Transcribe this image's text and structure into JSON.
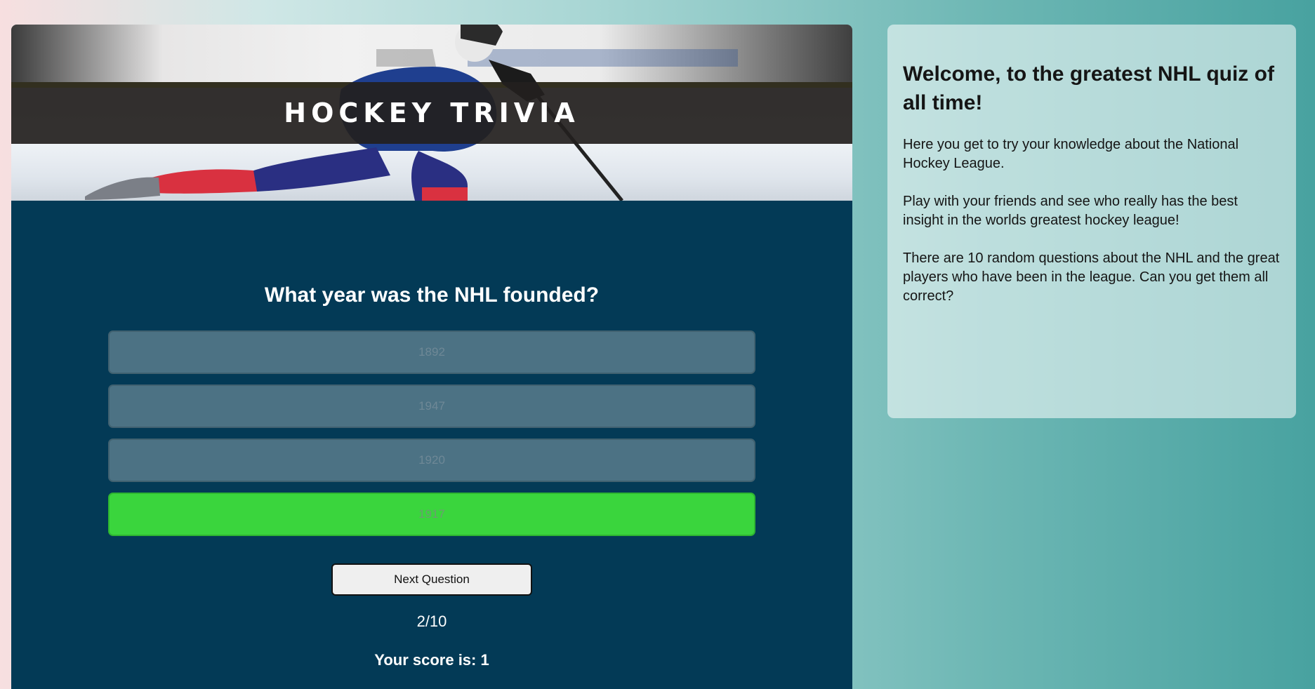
{
  "hero": {
    "title": "HOCKEY TRIVIA"
  },
  "quiz": {
    "question": "What year was the NHL founded?",
    "answers": [
      {
        "label": "1892",
        "state": "incorrect"
      },
      {
        "label": "1947",
        "state": "incorrect"
      },
      {
        "label": "1920",
        "state": "incorrect"
      },
      {
        "label": "1917",
        "state": "correct"
      }
    ],
    "next_button": "Next Question",
    "progress": "2/10",
    "score": "Your score is: 1"
  },
  "info": {
    "heading": "Welcome, to the greatest NHL quiz of all time!",
    "paragraphs": [
      "Here you get to try your knowledge about the National Hockey League.",
      "Play with your friends and see who really has the best insight in the worlds greatest hockey league!",
      "There are 10 random questions about the NHL and the great players who have been in the league. Can you get them all correct?"
    ]
  },
  "colors": {
    "quiz_bg": "#033a56",
    "answer_bg": "#4c7284",
    "correct_bg": "#3ad53d",
    "info_card_bg": "#cfe2e1"
  }
}
